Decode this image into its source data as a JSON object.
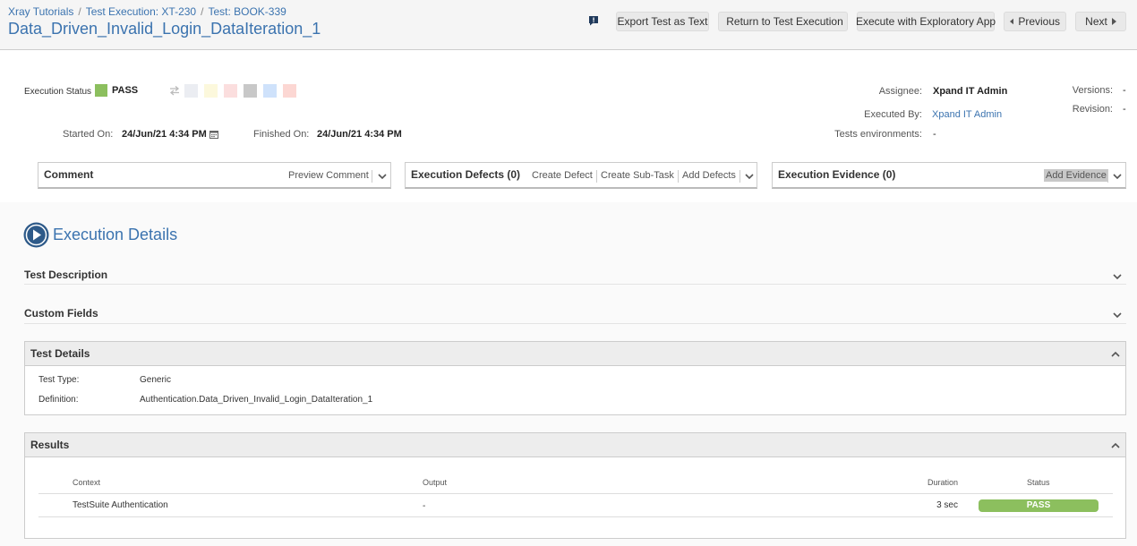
{
  "breadcrumb": {
    "items": [
      "Xray Tutorials",
      "Test Execution: XT-230",
      "Test: BOOK-339"
    ],
    "separator": "/"
  },
  "page_title": "Data_Driven_Invalid_Login_DataIteration_1",
  "toolbar": {
    "export_label": "Export Test as Text",
    "return_label": "Return to Test Execution",
    "exploratory_label": "Execute with Exploratory App",
    "previous_label": "Previous",
    "next_label": "Next"
  },
  "execution": {
    "status_label": "Execution Status",
    "status_value": "PASS",
    "status_color": "#8cbf5e",
    "started_label": "Started On:",
    "started_value": "24/Jun/21 4:34 PM",
    "finished_label": "Finished On:",
    "finished_value": "24/Jun/21 4:34 PM",
    "assignee_label": "Assignee:",
    "assignee_value": "Xpand IT Admin",
    "executed_by_label": "Executed By:",
    "executed_by_value": "Xpand IT Admin",
    "environments_label": "Tests environments:",
    "environments_value": "-",
    "versions_label": "Versions:",
    "versions_value": "-",
    "revision_label": "Revision:",
    "revision_value": "-",
    "status_swatches": [
      "#ebedf2",
      "#fcf8dc",
      "#fbdede",
      "#c8c8c8",
      "#cfe2fb",
      "#fcd7d3"
    ]
  },
  "panels": {
    "comment": {
      "title": "Comment",
      "action": "Preview Comment"
    },
    "defects": {
      "title": "Execution Defects (0)",
      "actions": [
        "Create Defect",
        "Create Sub-Task",
        "Add Defects"
      ]
    },
    "evidence": {
      "title": "Execution Evidence (0)",
      "action": "Add Evidence"
    }
  },
  "details": {
    "heading": "Execution Details",
    "test_description": "Test Description",
    "custom_fields": "Custom Fields",
    "test_details": {
      "title": "Test Details",
      "type_label": "Test Type:",
      "type_value": "Generic",
      "definition_label": "Definition:",
      "definition_value": "Authentication.Data_Driven_Invalid_Login_DataIteration_1"
    },
    "results": {
      "title": "Results",
      "columns": [
        "Context",
        "Output",
        "Duration",
        "Status"
      ],
      "rows": [
        {
          "context": "TestSuite Authentication",
          "output": "-",
          "duration": "3 sec",
          "status": "PASS"
        }
      ]
    }
  }
}
